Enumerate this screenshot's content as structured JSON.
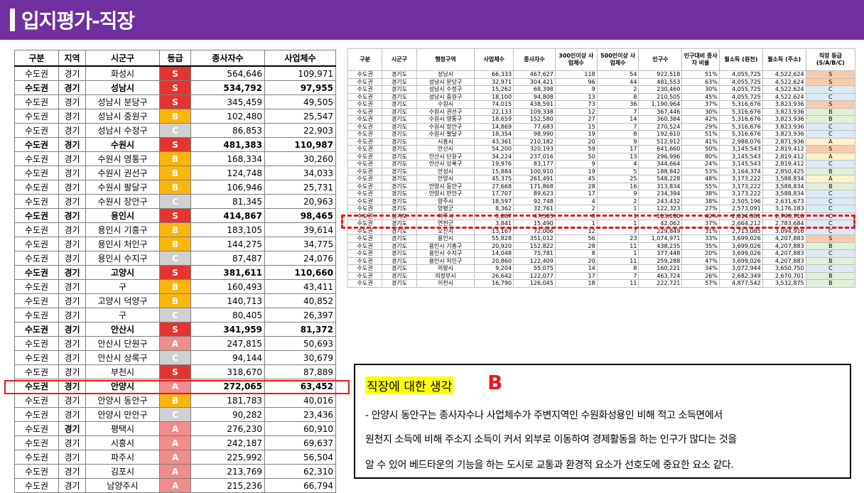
{
  "header": {
    "title": "입지평가-직장"
  },
  "left_table": {
    "headers": [
      "구분",
      "지역",
      "시군구",
      "등급",
      "종사자수",
      "사업체수"
    ],
    "rows": [
      {
        "region": "수도권",
        "prov": "경기",
        "city": "화성시",
        "grade": "S",
        "workers": "564,646",
        "biz": "109,971",
        "bold": false
      },
      {
        "region": "수도권",
        "prov": "경기",
        "city": "성남시",
        "grade": "S",
        "workers": "534,792",
        "biz": "97,955",
        "bold": true
      },
      {
        "region": "수도권",
        "prov": "경기",
        "city": "성남시 분당구",
        "grade": "S",
        "workers": "345,459",
        "biz": "49,505",
        "bold": false
      },
      {
        "region": "수도권",
        "prov": "경기",
        "city": "성남시 중원구",
        "grade": "B",
        "workers": "102,480",
        "biz": "25,547",
        "bold": false
      },
      {
        "region": "수도권",
        "prov": "경기",
        "city": "성남시 수정구",
        "grade": "C",
        "workers": "86,853",
        "biz": "22,903",
        "bold": false
      },
      {
        "region": "수도권",
        "prov": "경기",
        "city": "수원시",
        "grade": "S",
        "workers": "481,383",
        "biz": "110,987",
        "bold": true
      },
      {
        "region": "수도권",
        "prov": "경기",
        "city": "수원시 영통구",
        "grade": "B",
        "workers": "168,334",
        "biz": "30,260",
        "bold": false
      },
      {
        "region": "수도권",
        "prov": "경기",
        "city": "수원시 권선구",
        "grade": "B",
        "workers": "124,748",
        "biz": "34,033",
        "bold": false
      },
      {
        "region": "수도권",
        "prov": "경기",
        "city": "수원시 팔달구",
        "grade": "B",
        "workers": "106,946",
        "biz": "25,731",
        "bold": false
      },
      {
        "region": "수도권",
        "prov": "경기",
        "city": "수원시 장안구",
        "grade": "C",
        "workers": "81,345",
        "biz": "20,963",
        "bold": false
      },
      {
        "region": "수도권",
        "prov": "경기",
        "city": "용인시",
        "grade": "S",
        "workers": "414,867",
        "biz": "98,465",
        "bold": true
      },
      {
        "region": "수도권",
        "prov": "경기",
        "city": "용인시 기흥구",
        "grade": "B",
        "workers": "183,105",
        "biz": "39,614",
        "bold": false
      },
      {
        "region": "수도권",
        "prov": "경기",
        "city": "용인시 처인구",
        "grade": "B",
        "workers": "144,275",
        "biz": "34,775",
        "bold": false
      },
      {
        "region": "수도권",
        "prov": "경기",
        "city": "용인시 수지구",
        "grade": "C",
        "workers": "87,487",
        "biz": "24,076",
        "bold": false
      },
      {
        "region": "수도권",
        "prov": "경기",
        "city": "고양시",
        "grade": "S",
        "workers": "381,611",
        "biz": "110,660",
        "bold": true
      },
      {
        "region": "수도권",
        "prov": "경기",
        "city": "구",
        "grade": "B",
        "workers": "160,493",
        "biz": "43,411",
        "bold": false
      },
      {
        "region": "수도권",
        "prov": "경기",
        "city": "고양시 덕양구",
        "grade": "B",
        "workers": "140,713",
        "biz": "40,852",
        "bold": false
      },
      {
        "region": "수도권",
        "prov": "경기",
        "city": "구",
        "grade": "C",
        "workers": "80,405",
        "biz": "26,397",
        "bold": false
      },
      {
        "region": "수도권",
        "prov": "경기",
        "city": "안산시",
        "grade": "S",
        "workers": "341,959",
        "biz": "81,372",
        "bold": true
      },
      {
        "region": "수도권",
        "prov": "경기",
        "city": "안산시 단원구",
        "grade": "A",
        "workers": "247,815",
        "biz": "50,693",
        "bold": false
      },
      {
        "region": "수도권",
        "prov": "경기",
        "city": "안산시 상록구",
        "grade": "C",
        "workers": "94,144",
        "biz": "30,679",
        "bold": false
      },
      {
        "region": "수도권",
        "prov": "경기",
        "city": "부천시",
        "grade": "S",
        "workers": "318,670",
        "biz": "87,889",
        "bold": false
      },
      {
        "region": "수도권",
        "prov": "경기",
        "city": "안양시",
        "grade": "A",
        "workers": "272,065",
        "biz": "63,452",
        "bold": true
      },
      {
        "region": "수도권",
        "prov": "경기",
        "city": "안양시 동안구",
        "grade": "B",
        "workers": "181,783",
        "biz": "40,016",
        "bold": false
      },
      {
        "region": "수도권",
        "prov": "경기",
        "city": "안양시 만안구",
        "grade": "C",
        "workers": "90,282",
        "biz": "23,436",
        "bold": false
      },
      {
        "region": "수도권",
        "prov": "경기",
        "city": "평택시",
        "grade": "A",
        "workers": "276,230",
        "biz": "60,910",
        "bold": false,
        "provbold": true
      },
      {
        "region": "수도권",
        "prov": "경기",
        "city": "시흥시",
        "grade": "A",
        "workers": "242,187",
        "biz": "69,637",
        "bold": false
      },
      {
        "region": "수도권",
        "prov": "경기",
        "city": "파주시",
        "grade": "A",
        "workers": "225,992",
        "biz": "56,504",
        "bold": false
      },
      {
        "region": "수도권",
        "prov": "경기",
        "city": "김포시",
        "grade": "A",
        "workers": "213,769",
        "biz": "62,310",
        "bold": false
      },
      {
        "region": "수도권",
        "prov": "경기",
        "city": "남양주시",
        "grade": "A",
        "workers": "215,236",
        "biz": "66,794",
        "bold": false
      }
    ]
  },
  "right_table": {
    "headers": [
      "구분",
      "시군구",
      "행정구역",
      "사업체수",
      "종사자수",
      "300인이상 사업체수",
      "500인이상 사업체수",
      "인구수",
      "인구대비 종사자 비율",
      "월소득 (원천)",
      "월소득 (주소)",
      "직장 등급 (S/A/B/C)"
    ],
    "rows": [
      [
        "수도권",
        "경기도",
        "성남시",
        "66,333",
        "467,627",
        "118",
        "54",
        "922,518",
        "51%",
        "4,055,725",
        "4,522,624",
        "S"
      ],
      [
        "수도권",
        "경기도",
        "성남시 분당구",
        "32,971",
        "304,421",
        "96",
        "44",
        "481,553",
        "63%",
        "4,055,725",
        "4,522,624",
        "S"
      ],
      [
        "수도권",
        "경기도",
        "성남시 수정구",
        "15,262",
        "68,398",
        "9",
        "2",
        "230,460",
        "30%",
        "4,055,725",
        "4,522,624",
        "C"
      ],
      [
        "수도권",
        "경기도",
        "성남시 중원구",
        "18,100",
        "94,808",
        "13",
        "8",
        "210,505",
        "45%",
        "4,055,725",
        "4,522,624",
        "C"
      ],
      [
        "수도권",
        "경기도",
        "수원시",
        "74,015",
        "438,591",
        "73",
        "36",
        "1,190,964",
        "37%",
        "5,316,676",
        "3,823,936",
        "S"
      ],
      [
        "수도권",
        "경기도",
        "수원시 권선구",
        "22,133",
        "109,338",
        "12",
        "7",
        "367,446",
        "30%",
        "5,316,676",
        "3,823,936",
        "B"
      ],
      [
        "수도권",
        "경기도",
        "수원시 영통구",
        "18,659",
        "152,580",
        "27",
        "14",
        "360,384",
        "42%",
        "5,316,676",
        "3,823,936",
        "B"
      ],
      [
        "수도권",
        "경기도",
        "수원시 장안구",
        "14,869",
        "77,683",
        "15",
        "7",
        "270,524",
        "29%",
        "5,316,676",
        "3,823,936",
        "C"
      ],
      [
        "수도권",
        "경기도",
        "수원시 팔달구",
        "18,354",
        "98,990",
        "19",
        "8",
        "192,610",
        "51%",
        "5,316,676",
        "3,823,936",
        "C"
      ],
      [
        "수도권",
        "경기도",
        "시흥시",
        "43,361",
        "210,182",
        "20",
        "9",
        "512,912",
        "41%",
        "2,988,076",
        "2,871,936",
        "A"
      ],
      [
        "수도권",
        "경기도",
        "안산시",
        "54,200",
        "320,193",
        "59",
        "17",
        "641,660",
        "50%",
        "3,145,543",
        "2,819,412",
        "S"
      ],
      [
        "수도권",
        "경기도",
        "안산시 단원구",
        "34,224",
        "237,016",
        "50",
        "13",
        "296,996",
        "80%",
        "3,145,543",
        "2,819,412",
        "A"
      ],
      [
        "수도권",
        "경기도",
        "안산시 상록구",
        "19,976",
        "83,177",
        "9",
        "4",
        "344,664",
        "24%",
        "3,145,543",
        "2,819,412",
        "C"
      ],
      [
        "수도권",
        "경기도",
        "안성시",
        "15,884",
        "100,910",
        "19",
        "5",
        "188,842",
        "53%",
        "3,164,374",
        "2,850,425",
        "B"
      ],
      [
        "수도권",
        "경기도",
        "안양시",
        "45,375",
        "261,491",
        "45",
        "25",
        "548,228",
        "48%",
        "3,173,222",
        "3,588,834",
        "A"
      ],
      [
        "수도권",
        "경기도",
        "안양시 동안구",
        "27,668",
        "171,868",
        "28",
        "16",
        "313,834",
        "55%",
        "3,173,222",
        "3,588,834",
        "B"
      ],
      [
        "수도권",
        "경기도",
        "안양시 만안구",
        "17,707",
        "89,623",
        "17",
        "9",
        "234,394",
        "38%",
        "3,173,222",
        "3,588,834",
        "C"
      ],
      [
        "수도권",
        "경기도",
        "양주시",
        "18,597",
        "92,748",
        "4",
        "2",
        "243,432",
        "38%",
        "2,505,196",
        "2,631,673",
        "C"
      ],
      [
        "수도권",
        "경기도",
        "양평군",
        "8,362",
        "32,761",
        "2",
        "1",
        "122,323",
        "27%",
        "2,573,091",
        "3,176,183",
        "C"
      ],
      [
        "수도권",
        "경기도",
        "여주시",
        "9,287",
        "47,505",
        "8",
        "1",
        "113,150",
        "42%",
        "2,814,581",
        "2,795,718",
        "C"
      ],
      [
        "수도권",
        "경기도",
        "연천군",
        "3,841",
        "15,490",
        "1",
        "1",
        "42,062",
        "37%",
        "2,664,212",
        "2,783,684",
        "C"
      ],
      [
        "수도권",
        "경기도",
        "오산시",
        "13,167",
        "72,006",
        "12",
        "7",
        "229,849",
        "31%",
        "2,713,085",
        "3,094,916",
        "C"
      ],
      [
        "수도권",
        "경기도",
        "용인시",
        "55,828",
        "351,012",
        "56",
        "23",
        "1,074,971",
        "33%",
        "3,699,026",
        "4,207,883",
        "S"
      ],
      [
        "수도권",
        "경기도",
        "용인시 기흥구",
        "20,920",
        "152,822",
        "28",
        "11",
        "438,235",
        "35%",
        "3,699,026",
        "4,207,883",
        "B"
      ],
      [
        "수도권",
        "경기도",
        "용인시 수지구",
        "14,048",
        "75,781",
        "8",
        "1",
        "377,448",
        "20%",
        "3,699,026",
        "4,207,883",
        "C"
      ],
      [
        "수도권",
        "경기도",
        "용인시 처인구",
        "20,860",
        "122,409",
        "20",
        "11",
        "259,288",
        "47%",
        "3,699,026",
        "4,207,883",
        "B"
      ],
      [
        "수도권",
        "경기도",
        "의왕시",
        "9,204",
        "55,075",
        "14",
        "8",
        "160,221",
        "34%",
        "3,072,944",
        "3,650,750",
        "C"
      ],
      [
        "수도권",
        "경기도",
        "의정부시",
        "26,642",
        "122,077",
        "17",
        "7",
        "463,724",
        "26%",
        "2,682,349",
        "2,670,701",
        "B"
      ],
      [
        "수도권",
        "경기도",
        "이천시",
        "16,790",
        "126,045",
        "18",
        "11",
        "222,721",
        "57%",
        "4,877,542",
        "3,532,875",
        "B"
      ]
    ]
  },
  "note": {
    "heading": "직장에 대한 생각",
    "grade": "B",
    "line1": "- 안양시 동안구는 종사자수나 사업체수가 주변지역인 수원화성용인 비해 적고 소득면에서",
    "line2": "원천지 소득에 비해 주소지 소득이 커서 외부로 이동하여 경제활동을 하는 인구가 많다는 것을",
    "line3": "알 수 있어 베드타운의 기능을 하는 도시로 교통과 환경적 요소가 선호도에 중요한 요소 같다."
  }
}
